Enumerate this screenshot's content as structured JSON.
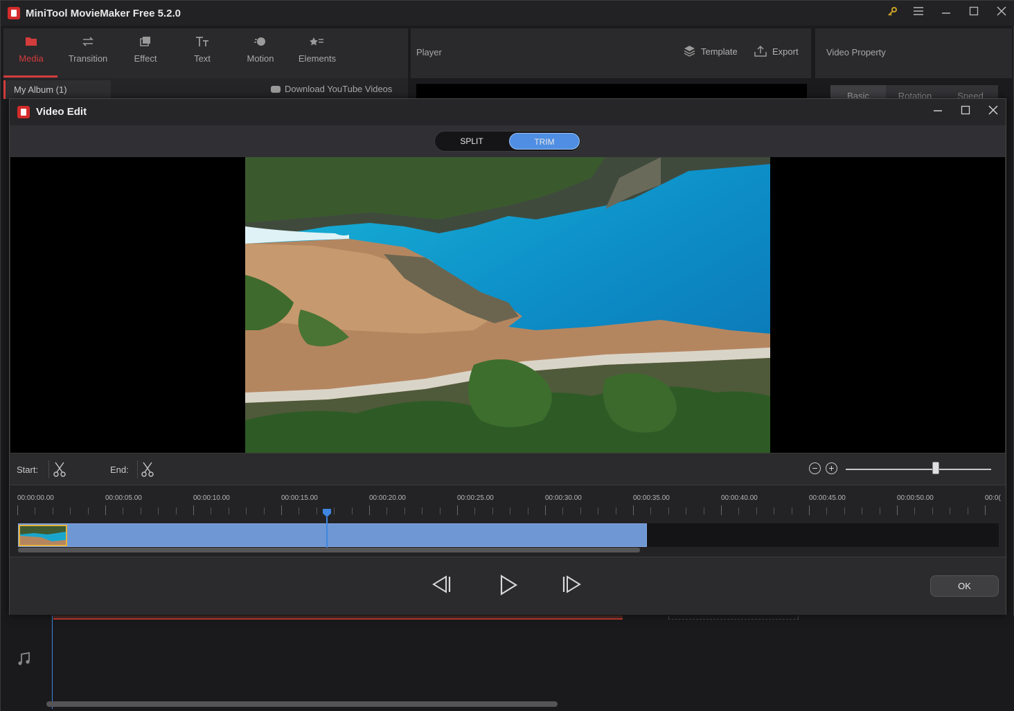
{
  "app": {
    "title": "MiniTool MovieMaker Free 5.2.0",
    "accent_color": "#d43c3c",
    "window_icons": [
      "key-icon",
      "menu-icon",
      "minimize-icon",
      "maximize-icon",
      "close-icon"
    ]
  },
  "toolbar": {
    "items": [
      {
        "label": "Media",
        "icon": "folder-icon",
        "active": true
      },
      {
        "label": "Transition",
        "icon": "swap-arrows-icon",
        "active": false
      },
      {
        "label": "Effect",
        "icon": "layers-icon",
        "active": false
      },
      {
        "label": "Text",
        "icon": "text-icon",
        "active": false
      },
      {
        "label": "Motion",
        "icon": "motion-icon",
        "active": false
      },
      {
        "label": "Elements",
        "icon": "elements-icon",
        "active": false
      }
    ]
  },
  "media": {
    "album": "My Album (1)",
    "download": "Download YouTube Videos"
  },
  "player": {
    "label": "Player",
    "template": "Template",
    "export": "Export"
  },
  "property": {
    "label": "Video Property",
    "tabs": [
      "Basic",
      "Rotation",
      "Speed"
    ]
  },
  "dialog": {
    "title": "Video Edit",
    "modes": [
      "SPLIT",
      "TRIM"
    ],
    "active_mode": "TRIM",
    "start_label": "Start:",
    "end_label": "End:",
    "zoom_level": 0.62,
    "ok_label": "OK"
  },
  "timeline": {
    "ticks": [
      "00:00:00.00",
      "00:00:05.00",
      "00:00:10.00",
      "00:00:15.00",
      "00:00:20.00",
      "00:00:25.00",
      "00:00:30.00",
      "00:00:35.00",
      "00:00:40.00",
      "00:00:45.00",
      "00:00:50.00",
      "00:0("
    ],
    "playhead_time": "00:00:17.50",
    "clip_duration_fraction": 0.64
  }
}
